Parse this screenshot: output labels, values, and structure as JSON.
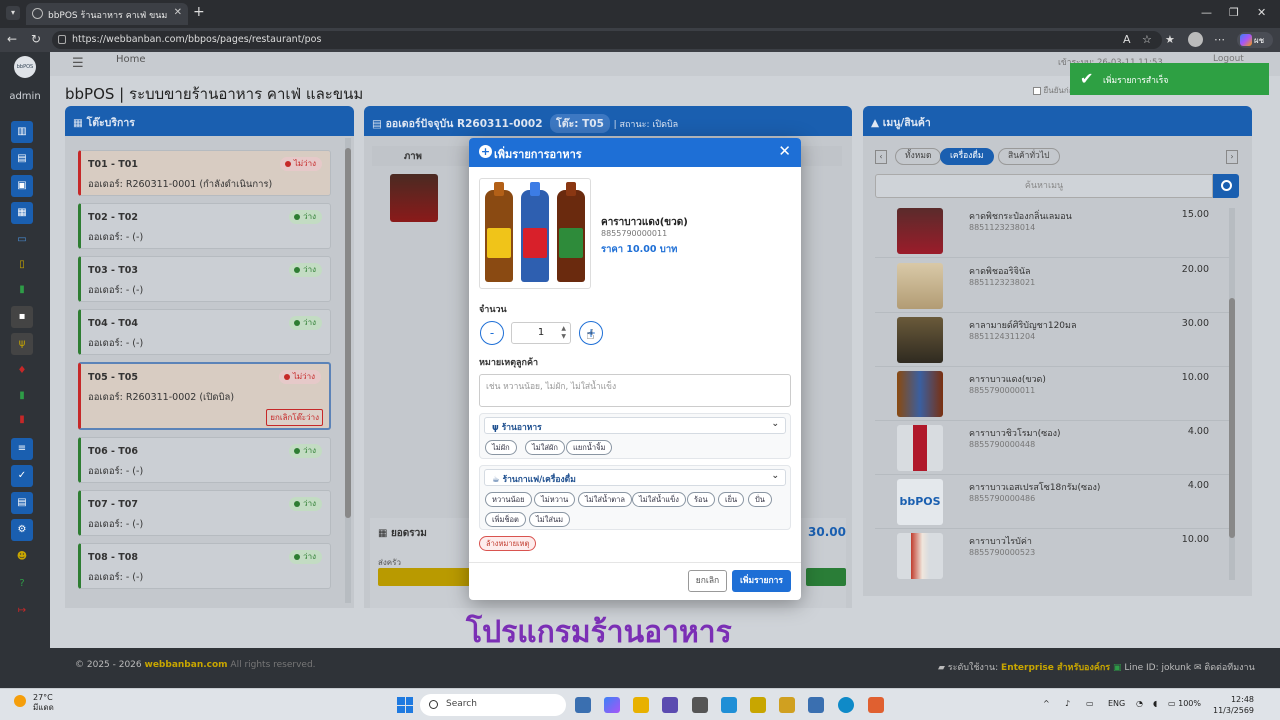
{
  "browser": {
    "tab_title": "bbPOS ร้านอาหาร คาเฟ่ ขนม",
    "url": "https://webbanban.com/bbpos/pages/restaurant/pos",
    "copilot_label": "ผช"
  },
  "sidebar": {
    "admin_label": "admin",
    "logo_text": "bbPOS"
  },
  "header": {
    "home_link": "Home",
    "login_time": "เข้าระบบ: 26-03-11 11:53",
    "logout": "Logout",
    "app_title": "bbPOS | ระบบขายร้านอาหาร คาเฟ่ และขนม",
    "controls": "ยืนยันก่อนแสดง เพิ่ม"
  },
  "toast": {
    "message": "เพิ่มรายการสำเร็จ"
  },
  "tables_panel": {
    "title": "โต๊ะบริการ",
    "tables": [
      {
        "name": "T01 - T01",
        "status": "ไม่ว่าง",
        "order": "ออเดอร์: R260311-0001 (กำลังดำเนินการ)"
      },
      {
        "name": "T02 - T02",
        "status": "ว่าง",
        "order": "ออเดอร์: - (-)"
      },
      {
        "name": "T03 - T03",
        "status": "ว่าง",
        "order": "ออเดอร์: - (-)"
      },
      {
        "name": "T04 - T04",
        "status": "ว่าง",
        "order": "ออเดอร์: - (-)"
      },
      {
        "name": "T05 - T05",
        "status": "ไม่ว่าง",
        "order": "ออเดอร์: R260311-0002 (เปิดบิล)"
      },
      {
        "name": "T06 - T06",
        "status": "ว่าง",
        "order": "ออเดอร์: - (-)"
      },
      {
        "name": "T07 - T07",
        "status": "ว่าง",
        "order": "ออเดอร์: - (-)"
      },
      {
        "name": "T08 - T08",
        "status": "ว่าง",
        "order": "ออเดอร์: - (-)"
      }
    ],
    "clear_table_label": "ยกเลิกโต๊ะว่าง"
  },
  "order_panel": {
    "title": "ออเดอร์ปัจจุบัน R260311-0002",
    "table_badge": "โต๊ะ: T05",
    "status": "| สถานะ: เปิดบิล",
    "col_image": "ภาพ",
    "total_label": "ยอดรวม",
    "total_value": "30.00",
    "kitchen_label": "ส่งครัว"
  },
  "menu_panel": {
    "title": "เมนู/สินค้า",
    "tabs": [
      "ทั้งหมด",
      "เครื่องดื่ม",
      "สินค้าทั่วไป"
    ],
    "search_placeholder": "ค้นหาเมนู",
    "items": [
      {
        "name": "คาดพิชกระป๋องกลิ่นเลมอน",
        "code": "8851123238014",
        "price": "15.00"
      },
      {
        "name": "คาดพิชออริจินัล",
        "code": "8851123238021",
        "price": "20.00"
      },
      {
        "name": "คาลามายด์ศิริบัญชา120มล",
        "code": "8851124311204",
        "price": "30.00"
      },
      {
        "name": "คาราบาวแดง(ขวด)",
        "code": "8855790000011",
        "price": "10.00"
      },
      {
        "name": "คาราบาวชิวโรมา(ซอง)",
        "code": "8855790000448",
        "price": "4.00"
      },
      {
        "name": "คาราบาวเอสเปรสโซ18กรัม(ซอง)",
        "code": "8855790000486",
        "price": "4.00"
      },
      {
        "name": "คาราบาวไรบัค่า",
        "code": "8855790000523",
        "price": "10.00"
      }
    ]
  },
  "modal": {
    "title": "เพิ่มรายการอาหาร",
    "product_name": "คาราบาวแดง(ขวด)",
    "product_code": "8855790000011",
    "product_price": "ราคา 10.00 บาท",
    "qty_label": "จำนวน",
    "qty_value": "1",
    "minus": "-",
    "plus": "+",
    "note_label": "หมายเหตุลูกค้า",
    "note_placeholder": "เช่น หวานน้อย, ไม่ผัก, ไม่ใส่น้ำแข็ง",
    "group1": {
      "title": "ร้านอาหาร",
      "chips": [
        "ไม่ผัก",
        "ไม่ใส่ผัก",
        "แยกน้ำจิ้ม"
      ]
    },
    "group2": {
      "title": "ร้านกาแฟ/เครื่องดื่ม",
      "chips": [
        "หวานน้อย",
        "ไม่หวาน",
        "ไม่ใส่น้ำตาล",
        "ไม่ใส่น้ำแข็ง",
        "ร้อน",
        "เย็น",
        "ปั่น",
        "เพิ่มช็อต",
        "ไม่ใส่นม"
      ]
    },
    "clear_note": "ล้างหมายเหตุ",
    "cancel": "ยกเลิก",
    "submit": "เพิ่มรายการ"
  },
  "overlay_caption": "โปรแกรมร้านอาหาร",
  "footer": {
    "copyright": "© 2025 - 2026",
    "brand": "webbanban.com",
    "rights": "All rights reserved.",
    "plan_label": "ระดับใช้งาน:",
    "plan": "Enterprise สำหรับองค์กร",
    "line": "Line ID: jokunk",
    "contact": "ติดต่อทีมงาน"
  },
  "taskbar": {
    "temp": "27°C",
    "weather": "มีแดด",
    "search": "Search",
    "lang": "ENG",
    "battery": "100%",
    "time": "12:48",
    "date": "11/3/2569"
  }
}
